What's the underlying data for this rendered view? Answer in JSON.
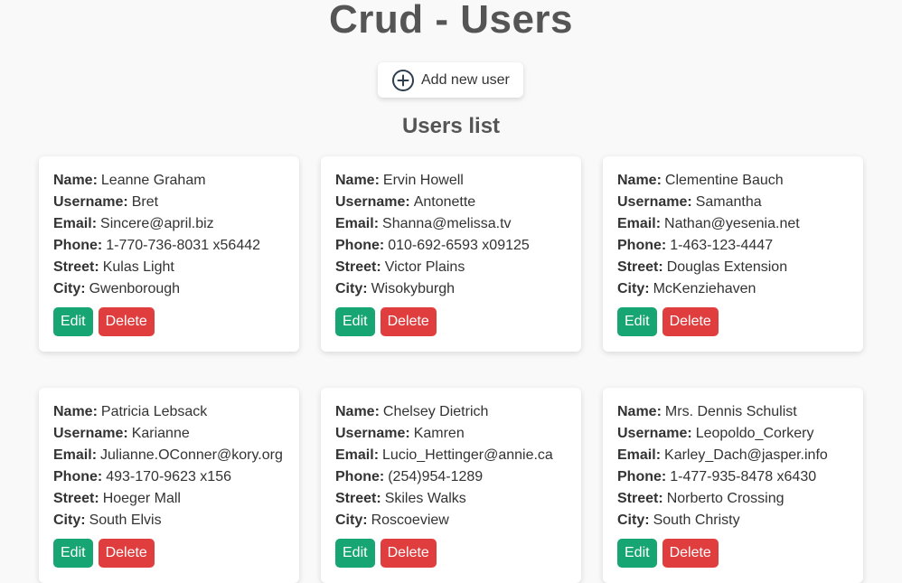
{
  "header": {
    "title": "Crud - Users",
    "add_button_label": "Add new user"
  },
  "list": {
    "title": "Users list",
    "labels": {
      "name": "Name:",
      "username": "Username:",
      "email": "Email:",
      "phone": "Phone:",
      "street": "Street:",
      "city": "City:"
    },
    "edit_label": "Edit",
    "delete_label": "Delete"
  },
  "users": [
    {
      "name": "Leanne Graham",
      "username": "Bret",
      "email": "Sincere@april.biz",
      "phone": "1-770-736-8031 x56442",
      "street": "Kulas Light",
      "city": "Gwenborough"
    },
    {
      "name": "Ervin Howell",
      "username": "Antonette",
      "email": "Shanna@melissa.tv",
      "phone": "010-692-6593 x09125",
      "street": "Victor Plains",
      "city": "Wisokyburgh"
    },
    {
      "name": "Clementine Bauch",
      "username": "Samantha",
      "email": "Nathan@yesenia.net",
      "phone": "1-463-123-4447",
      "street": "Douglas Extension",
      "city": "McKenziehaven"
    },
    {
      "name": "Patricia Lebsack",
      "username": "Karianne",
      "email": "Julianne.OConner@kory.org",
      "phone": "493-170-9623 x156",
      "street": "Hoeger Mall",
      "city": "South Elvis"
    },
    {
      "name": "Chelsey Dietrich",
      "username": "Kamren",
      "email": "Lucio_Hettinger@annie.ca",
      "phone": "(254)954-1289",
      "street": "Skiles Walks",
      "city": "Roscoeview"
    },
    {
      "name": "Mrs. Dennis Schulist",
      "username": "Leopoldo_Corkery",
      "email": "Karley_Dach@jasper.info",
      "phone": "1-477-935-8478 x6430",
      "street": "Norberto Crossing",
      "city": "South Christy"
    }
  ],
  "colors": {
    "edit": "#17a673",
    "delete": "#e03e3e",
    "add_icon": "#2c3e50"
  },
  "icons": {
    "add": "plus-circle-icon"
  }
}
